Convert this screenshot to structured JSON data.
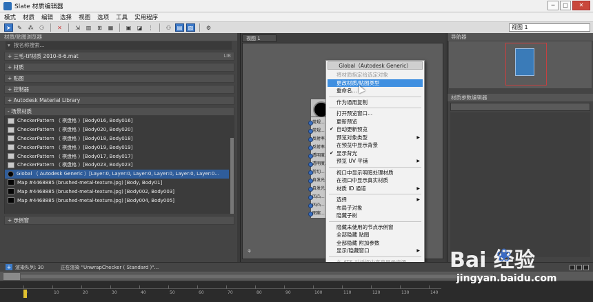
{
  "window": {
    "title": "Slate 材质编辑器",
    "buttons": [
      "─",
      "□",
      "✕"
    ]
  },
  "menubar": [
    "模式",
    "材质",
    "编辑",
    "选择",
    "视图",
    "选项",
    "工具",
    "实用程序"
  ],
  "toolbar": {
    "view_select": "视图 1"
  },
  "left_panel": {
    "header": "材质/贴图浏览器",
    "search_placeholder": "按名称搜索...",
    "rollouts_top": [
      {
        "label": "+ 三毛-tif材质 2010-8-6.mat",
        "right": "LIB"
      },
      {
        "label": "+ 材质",
        "right": ""
      },
      {
        "label": "+ 贴图",
        "right": ""
      },
      {
        "label": "+ 控制器",
        "right": ""
      },
      {
        "label": "+ Autodesk Material Library",
        "right": ""
      }
    ],
    "scene_rollout": "- 场景材质",
    "scene_materials": [
      {
        "label": "CheckerPattern （ 棋盘格 ）[Body016, Body016]",
        "swatch": "checker"
      },
      {
        "label": "CheckerPattern （ 棋盘格 ）[Body020, Body020]",
        "swatch": "checker"
      },
      {
        "label": "CheckerPattern （ 棋盘格 ）[Body018, Body018]",
        "swatch": "checker"
      },
      {
        "label": "CheckerPattern （ 棋盘格 ）[Body019, Body019]",
        "swatch": "checker"
      },
      {
        "label": "CheckerPattern （ 棋盘格 ）[Body017, Body017]",
        "swatch": "checker"
      },
      {
        "label": "CheckerPattern （ 棋盘格 ）[Body023, Body023]",
        "swatch": "checker"
      },
      {
        "label": "Global （ Autodesk Generic ）[Layer:0, Layer:0, Layer:0, Layer:0, Layer:0, Layer:0...",
        "swatch": "sphere",
        "selected": true
      },
      {
        "label": "Map #4468885 (brushed-metal-texture.jpg) [Body, Body01]",
        "swatch": "dark"
      },
      {
        "label": "Map #4468885 (brushed-metal-texture.jpg) [Body002, Body003]",
        "swatch": "dark"
      },
      {
        "label": "Map #4468885 (brushed-metal-texture.jpg) [Body004, Body005]",
        "swatch": "dark"
      }
    ],
    "sample_rollout": "+ 示例窗"
  },
  "view_panel": {
    "tab": "视图 1",
    "node_slots": [
      "常规...",
      "常规...",
      "反射率...",
      "反射率...",
      "透明度...",
      "透明度...",
      "剪切...",
      "自发光...",
      "自发光...",
      "凹凸...",
      "凹凸...",
      "图案..."
    ]
  },
  "context_menu": {
    "header": "Global（Autodesk Generic）",
    "items": [
      {
        "label": "将材质指定给选定对象",
        "dim": true
      },
      {
        "label": "更改材质/贴图类型",
        "highlight": true
      },
      {
        "label": "重命名..."
      },
      {
        "sep": true
      },
      {
        "label": "作为通用复制"
      },
      {
        "sep": true
      },
      {
        "label": "打开预览窗口..."
      },
      {
        "label": "更新预览"
      },
      {
        "label": "自动更新预览",
        "check": true
      },
      {
        "label": "预览对象类型",
        "submenu": true
      },
      {
        "label": "在预览中显示背景"
      },
      {
        "label": "显示背光",
        "check": true
      },
      {
        "label": "预览 UV 平铺",
        "submenu": true
      },
      {
        "sep": true
      },
      {
        "label": "视口中显示明暗处理材质"
      },
      {
        "label": "在视口中显示真实材质"
      },
      {
        "label": "材质 ID 通道",
        "submenu": true
      },
      {
        "sep": true
      },
      {
        "label": "选择",
        "submenu": true
      },
      {
        "label": "布局子对象"
      },
      {
        "label": "隐藏子树"
      },
      {
        "sep": true
      },
      {
        "label": "隐藏未使用的节点示例窗"
      },
      {
        "label": "全部隐藏 贴图"
      },
      {
        "label": "全部隐藏 附加参数"
      },
      {
        "label": "显示/隐藏窗口",
        "submenu": true
      },
      {
        "sep": true
      },
      {
        "label": "在 ATS 对话框中高亮显示资源...",
        "dim": true
      }
    ]
  },
  "right_panel": {
    "navigator_header": "导航器",
    "params_header": "材质参数编辑器"
  },
  "status_bar": {
    "text1": "渲染队列: 30",
    "text2": "正在渲染 \"UnwrapChecker ( Standard )\"..."
  },
  "timeline": {
    "ticks": [
      "0",
      "10",
      "20",
      "30",
      "40",
      "50",
      "60",
      "70",
      "80",
      "90",
      "100",
      "110",
      "120",
      "130",
      "140"
    ]
  },
  "watermark": {
    "text": "Bai  经验",
    "url": "jingyan.baidu.com"
  }
}
